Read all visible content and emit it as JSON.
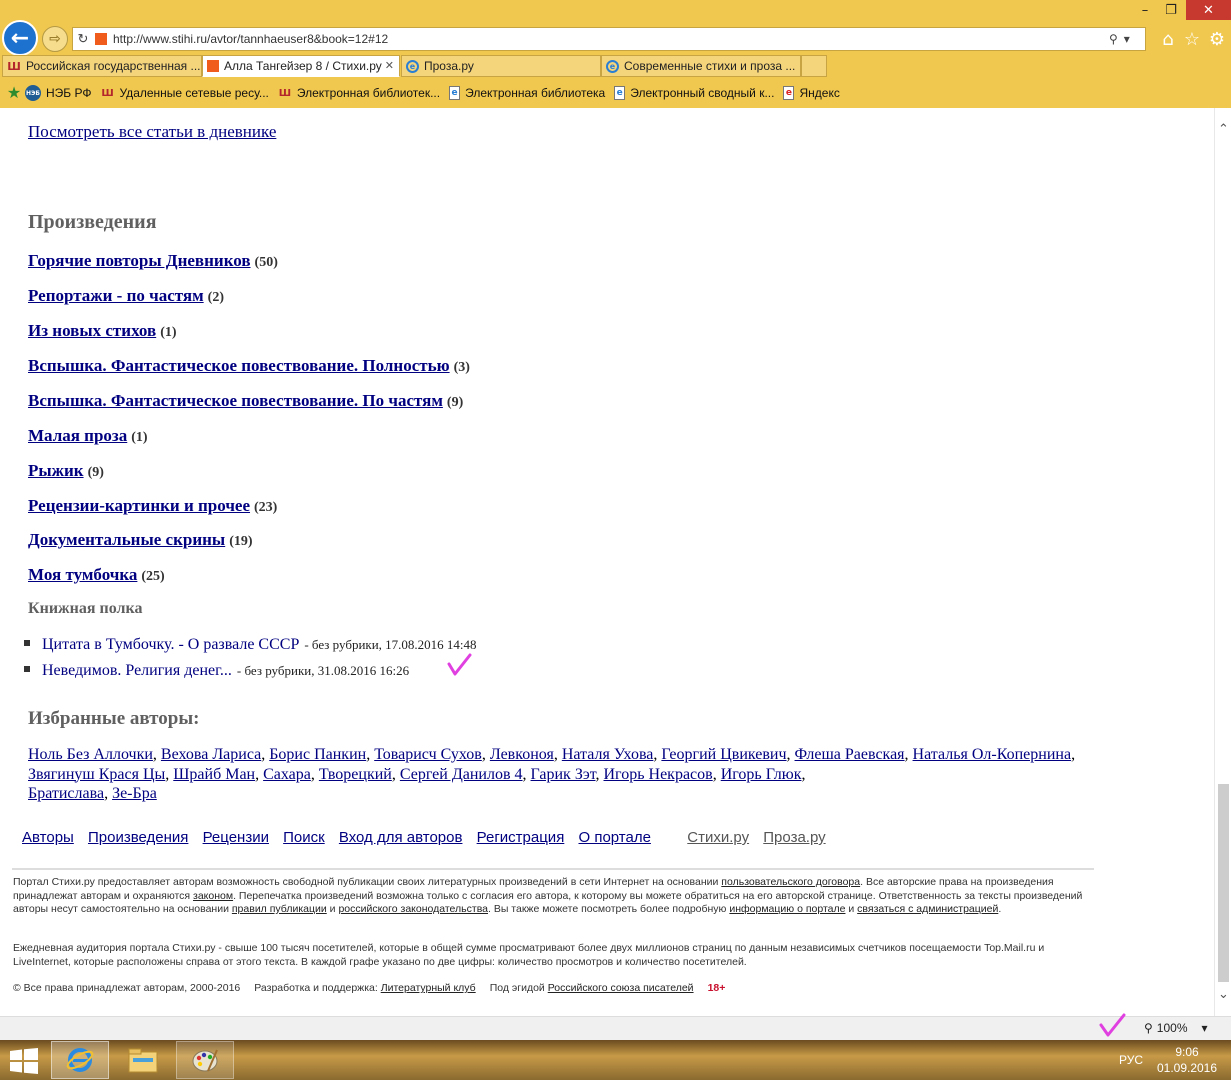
{
  "browser": {
    "url": "http://www.stihi.ru/avtor/tannhaeuser8&book=12#12",
    "tabs": [
      {
        "label": "Российская государственная ..."
      },
      {
        "label": "Алла Тангейзер 8 / Стихи.ру"
      },
      {
        "label": "Проза.ру"
      },
      {
        "label": "Современные стихи и проза ..."
      }
    ],
    "favorites": [
      {
        "label": "НЭБ РФ"
      },
      {
        "label": "Удаленные сетевые ресу..."
      },
      {
        "label": "Электронная библиотек..."
      },
      {
        "label": "Электронная библиотека"
      },
      {
        "label": "Электронный сводный к..."
      },
      {
        "label": "Яндекс"
      }
    ],
    "zoom": "100%",
    "icon_labels": {
      "fav_neb": "НЭБ"
    }
  },
  "page": {
    "diary_link": "Посмотреть все статьи в дневнике",
    "works_heading": "Произведения",
    "works": [
      {
        "title": "Горячие повторы Дневников",
        "count": "(50)"
      },
      {
        "title": "Репортажи - по частям",
        "count": "(2)"
      },
      {
        "title": "Из новых стихов",
        "count": "(1)"
      },
      {
        "title": "Вспышка. Фантастическое повествование. Полностью",
        "count": "(3)"
      },
      {
        "title": "Вспышка. Фантастическое повествование. По частям",
        "count": "(9)"
      },
      {
        "title": "Малая проза",
        "count": "(1)"
      },
      {
        "title": "Рыжик",
        "count": "(9)"
      },
      {
        "title": "Рецензии-картинки и прочее",
        "count": "(23)"
      },
      {
        "title": "Документальные скрины",
        "count": "(19)"
      },
      {
        "title": "Моя тумбочка",
        "count": "(25)"
      }
    ],
    "shelf_heading": "Книжная полка",
    "shelf": [
      {
        "title": "Цитата в Тумбочку. - О развале СССР",
        "meta": "- без рубрики, 17.08.2016 14:48"
      },
      {
        "title": "Неведимов. Религия денег...",
        "meta": "- без рубрики, 31.08.2016 16:26"
      }
    ],
    "authors_heading": "Избранные авторы:",
    "authors": [
      "Ноль Без Аллочки",
      "Вехова Лариса",
      "Борис Панкин",
      "Товарисч Сухов",
      "Левконоя",
      "Наталя Ухова",
      "Георгий Цвикевич",
      "Флеша Раевская",
      "Наталья Ол-Копернина",
      "Звягинуш Крася Цы",
      "Шрайб Ман",
      "Сахара",
      "Творецкий",
      "Сергей Данилов 4",
      "Гарик Зэт",
      "Игорь Некрасов",
      "Игорь Глюк",
      "Братислава",
      "Зе-Бра"
    ],
    "footer_nav": [
      "Авторы",
      "Произведения",
      "Рецензии",
      "Поиск",
      "Вход для авторов",
      "Регистрация",
      "О портале"
    ],
    "footer_sites": [
      "Стихи.ру",
      "Проза.ру"
    ],
    "legal1": {
      "p1": "Портал Стихи.ру предоставляет авторам возможность свободной публикации своих литературных произведений в сети Интернет на основании ",
      "l1": "пользовательского договора",
      "p2": ". Все авторские права на произведения принадлежат авторам и охраняются ",
      "l2": "законом",
      "p3": ". Перепечатка произведений возможна только с согласия его автора, к которому вы можете обратиться на его авторской странице. Ответственность за тексты произведений авторы несут самостоятельно на основании ",
      "l3": "правил публикации",
      "p4": " и ",
      "l4": "российского законодательства",
      "p5": ". Вы также можете посмотреть более подробную ",
      "l5": "информацию о портале",
      "p6": " и ",
      "l6": "связаться с администрацией",
      "p7": "."
    },
    "legal2": "Ежедневная аудитория портала Стихи.ру - свыше 100 тысяч посетителей, которые в общей сумме просматривают более двух миллионов страниц по данным независимых счетчиков посещаемости Top.Mail.ru и LiveInternet, которые расположены справа от этого текста. В каждой графе указано по две цифры: количество просмотров и количество посетителей.",
    "legal3": {
      "copyright": "© Все права принадлежат авторам, 2000-2016",
      "dev_label": "Разработка и поддержка:",
      "dev_link": "Литературный клуб",
      "aegis_label": "Под эгидой",
      "aegis_link": "Российского союза писателей",
      "age": "18+"
    }
  },
  "taskbar": {
    "lang": "РУС",
    "time": "9:06",
    "date": "01.09.2016"
  },
  "colors": {
    "link": "#000080",
    "heading": "#606060",
    "chrome": "#f1c84f",
    "check": "#e040e0"
  }
}
